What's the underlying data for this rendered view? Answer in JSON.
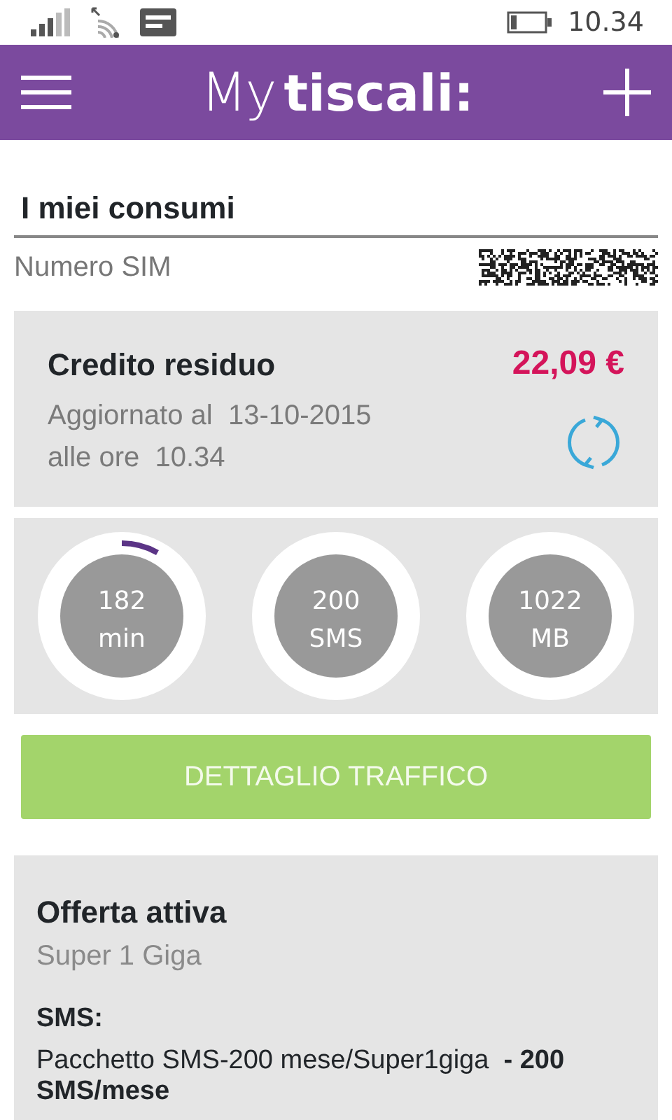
{
  "status_bar": {
    "time": "10.34"
  },
  "header": {
    "logo_prefix": "My",
    "logo_name": "tiscali:"
  },
  "page_title": "I miei consumi",
  "sim": {
    "label": "Numero SIM"
  },
  "credit": {
    "title": "Credito residuo",
    "amount": "22,09 €",
    "updated_label": "Aggiornato al",
    "updated_date": "13-10-2015",
    "time_label": "alle ore",
    "time": "10.34"
  },
  "gauges": [
    {
      "value": "182",
      "unit": "min",
      "used": true
    },
    {
      "value": "200",
      "unit": "SMS",
      "used": false
    },
    {
      "value": "1022",
      "unit": "MB",
      "used": false
    }
  ],
  "traffic_button": "DETTAGLIO TRAFFICO",
  "offer": {
    "title": "Offerta attiva",
    "name": "Super 1 Giga",
    "section": "SMS:",
    "detail": "Pacchetto SMS-200 mese/Super1giga  **- 200 SMS/mese**"
  }
}
